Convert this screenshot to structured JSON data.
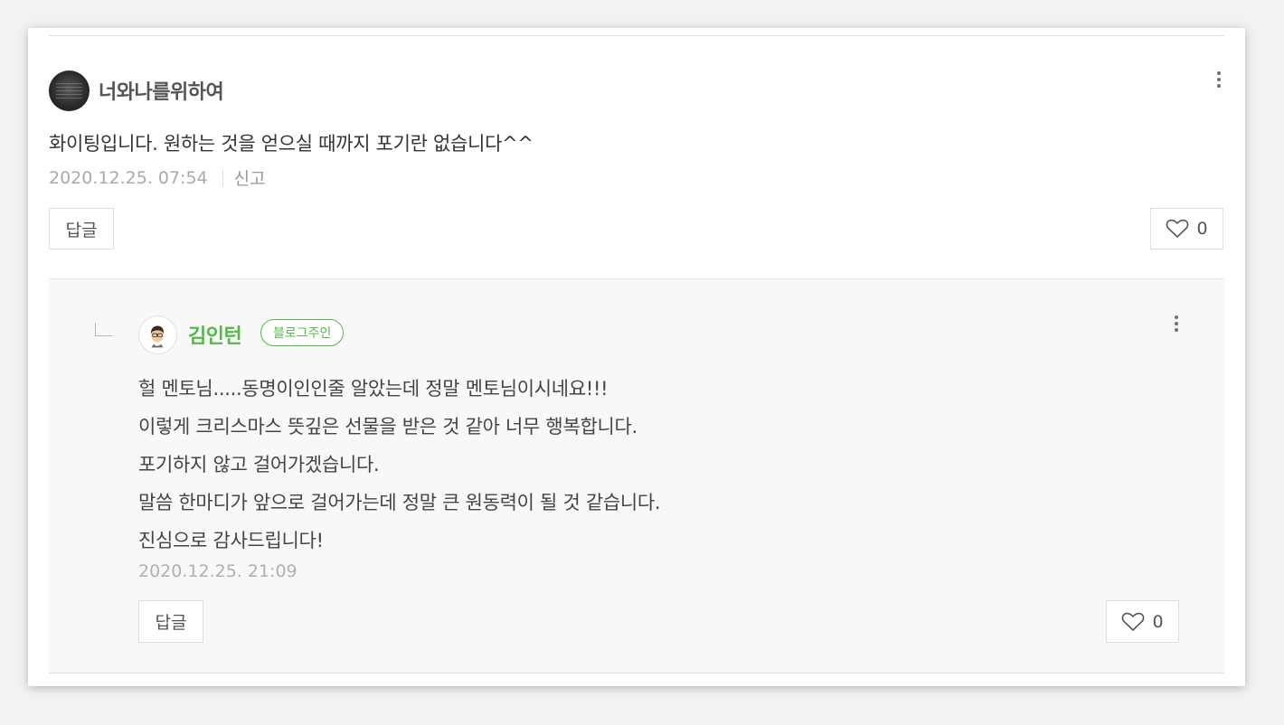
{
  "comment": {
    "author": "너와나를위하여",
    "content": "화이팅입니다. 원하는 것을 얻으실 때까지 포기란 없습니다^^",
    "date": "2020.12.25. 07:54",
    "report_label": "신고",
    "reply_button_label": "답글",
    "like_count": "0"
  },
  "reply": {
    "author": "김인턴",
    "owner_badge": "블로그주인",
    "lines": [
      "헐 멘토님.....동명이인인줄 알았는데 정말 멘토님이시네요!!!",
      "이렇게 크리스마스 뜻깊은 선물을 받은 것 같아 너무 행복합니다.",
      "포기하지 않고 걸어가겠습니다.",
      "말씀 한마디가 앞으로 걸어가는데 정말 큰 원동력이 될 것 같습니다.",
      "진심으로 감사드립니다!"
    ],
    "date": "2020.12.25. 21:09",
    "reply_button_label": "답글",
    "like_count": "0"
  },
  "colors": {
    "owner_green": "#54b948",
    "border": "#dedede",
    "reply_background": "#f8f8f8"
  },
  "icons": {
    "more": "more-vertical-icon",
    "like": "heart-outline-icon",
    "reply_indent": "reply-indent-icon"
  }
}
